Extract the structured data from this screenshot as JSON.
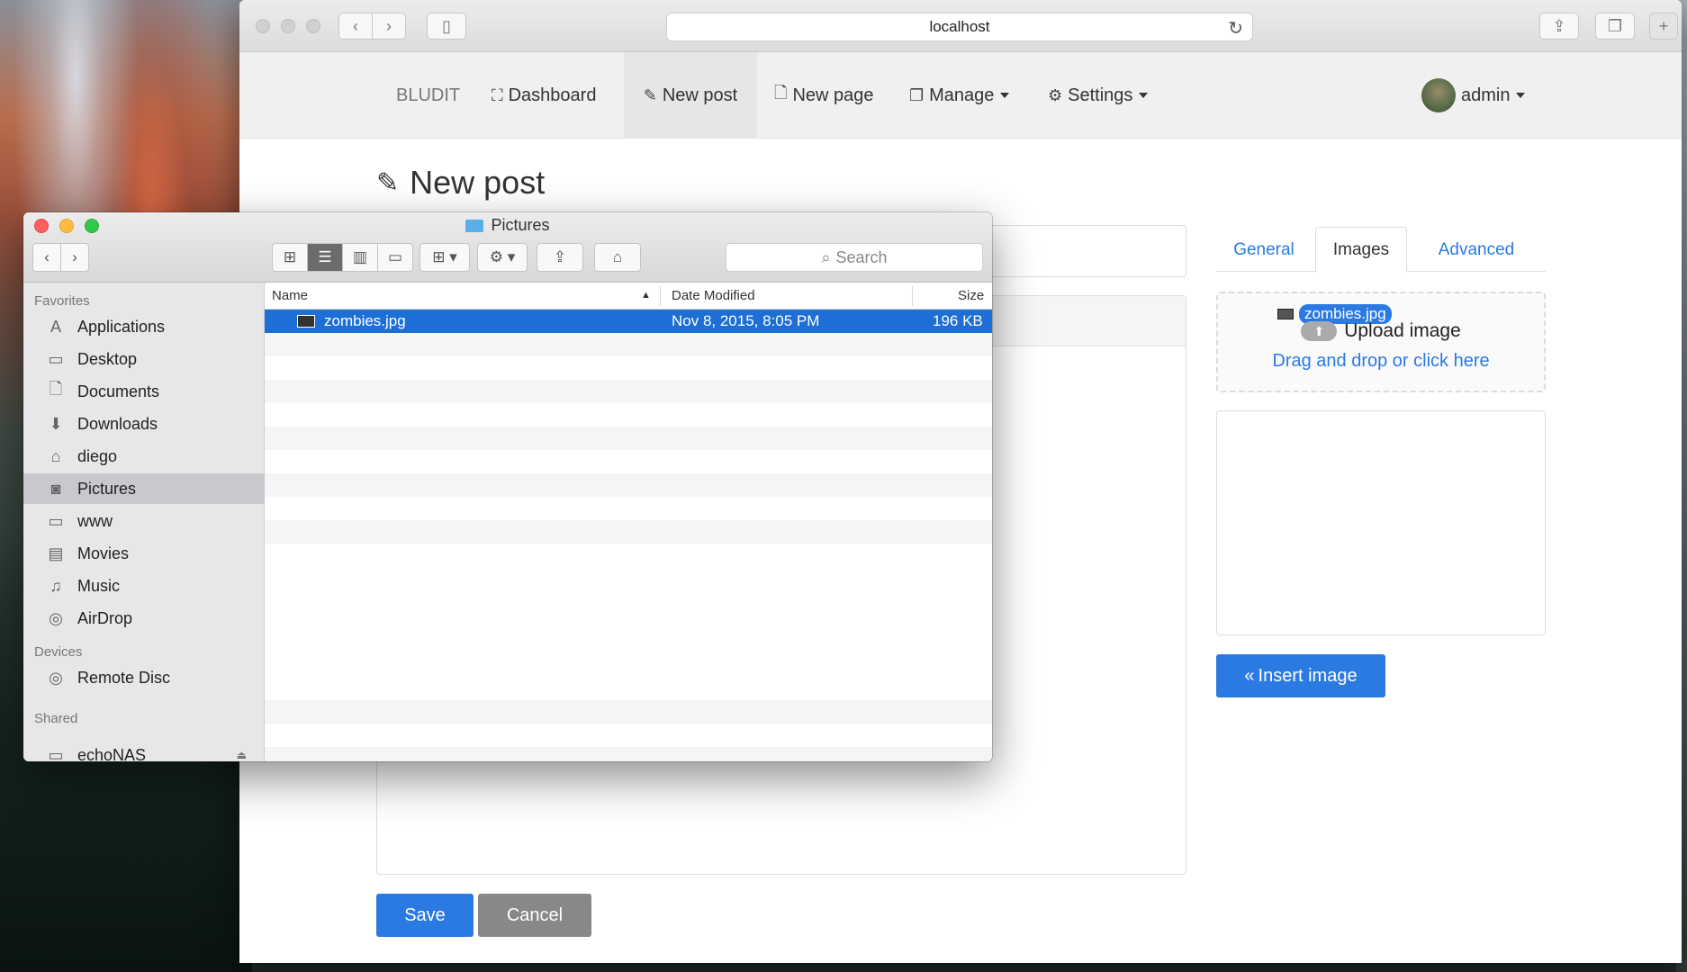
{
  "browser": {
    "url": "localhost",
    "reload_icon": "reload-icon"
  },
  "nav": {
    "brand": "BLUDIT",
    "dashboard": "Dashboard",
    "new_post": "New post",
    "new_page": "New page",
    "manage": "Manage",
    "settings": "Settings",
    "user": "admin"
  },
  "page": {
    "title": "New post"
  },
  "buttons": {
    "save": "Save",
    "cancel": "Cancel",
    "insert_image": "Insert image"
  },
  "tabs": {
    "general": "General",
    "images": "Images",
    "advanced": "Advanced"
  },
  "dropzone": {
    "file_name": "zombies.jpg",
    "upload_label": "Upload image",
    "link_text": "Drag and drop or click here"
  },
  "finder": {
    "title": "Pictures",
    "search_placeholder": "Search",
    "sidebar": {
      "favorites_heading": "Favorites",
      "favorites": [
        "Applications",
        "Desktop",
        "Documents",
        "Downloads",
        "diego",
        "Pictures",
        "www",
        "Movies",
        "Music",
        "AirDrop"
      ],
      "devices_heading": "Devices",
      "devices": [
        "Remote Disc"
      ],
      "shared_heading": "Shared",
      "shared": [
        "echoNAS"
      ]
    },
    "columns": {
      "name": "Name",
      "date": "Date Modified",
      "size": "Size"
    },
    "files": [
      {
        "name": "zombies.jpg",
        "date": "Nov 8, 2015, 8:05 PM",
        "size": "196 KB"
      }
    ]
  },
  "colors": {
    "accent": "#2a7ae2",
    "selection": "#1d6fd6",
    "close": "#fc605c",
    "minimize": "#fdbc40",
    "zoom": "#34c84a"
  }
}
